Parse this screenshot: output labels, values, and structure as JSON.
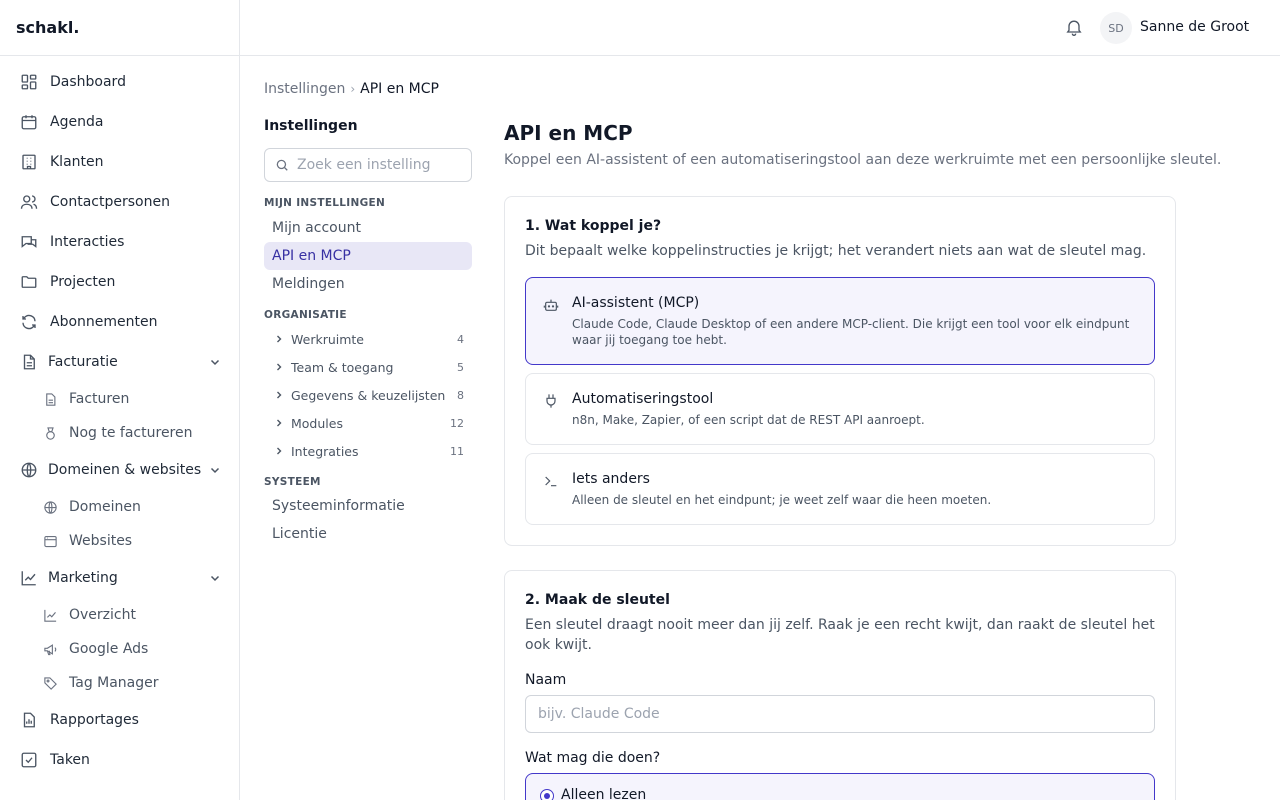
{
  "app": {
    "logo": "schakl."
  },
  "sidebar": {
    "items": [
      {
        "label": "Dashboard",
        "icon": "dashboard-icon"
      },
      {
        "label": "Agenda",
        "icon": "calendar-icon"
      },
      {
        "label": "Klanten",
        "icon": "building-icon"
      },
      {
        "label": "Contactpersonen",
        "icon": "users-icon"
      },
      {
        "label": "Interacties",
        "icon": "messages-icon"
      },
      {
        "label": "Projecten",
        "icon": "folder-icon"
      },
      {
        "label": "Abonnementen",
        "icon": "refresh-icon"
      }
    ],
    "facturatie": {
      "label": "Facturatie",
      "icon": "file-icon",
      "children": [
        {
          "label": "Facturen"
        },
        {
          "label": "Nog te factureren"
        }
      ]
    },
    "domeinen": {
      "label": "Domeinen & websites",
      "icon": "globe-icon",
      "children": [
        {
          "label": "Domeinen"
        },
        {
          "label": "Websites"
        }
      ]
    },
    "marketing": {
      "label": "Marketing",
      "icon": "chart-line-icon",
      "children": [
        {
          "label": "Overzicht"
        },
        {
          "label": "Google Ads"
        },
        {
          "label": "Tag Manager"
        }
      ]
    },
    "bottom": [
      {
        "label": "Rapportages",
        "icon": "report-icon"
      },
      {
        "label": "Taken",
        "icon": "checkbox-icon"
      }
    ]
  },
  "header": {
    "avatar_initials": "SD",
    "user_name": "Sanne de Groot"
  },
  "breadcrumb": {
    "parent": "Instellingen",
    "separator": "›",
    "current": "API en MCP"
  },
  "settings_nav": {
    "title": "Instellingen",
    "search_placeholder": "Zoek een instelling",
    "mijn": {
      "label": "MIJN INSTELLINGEN",
      "items": [
        "Mijn account",
        "API en MCP",
        "Meldingen"
      ]
    },
    "organisatie": {
      "label": "ORGANISATIE",
      "items": [
        {
          "label": "Werkruimte",
          "count": "4"
        },
        {
          "label": "Team & toegang",
          "count": "5"
        },
        {
          "label": "Gegevens & keuzelijsten",
          "count": "8"
        },
        {
          "label": "Modules",
          "count": "12"
        },
        {
          "label": "Integraties",
          "count": "11"
        }
      ]
    },
    "systeem": {
      "label": "SYSTEEM",
      "items": [
        "Systeeminformatie",
        "Licentie"
      ]
    }
  },
  "main": {
    "title": "API en MCP",
    "description": "Koppel een AI-assistent of een automatiseringstool aan deze werkruimte met een persoonlijke sleutel.",
    "step1": {
      "title": "1. Wat koppel je?",
      "description": "Dit bepaalt welke koppelinstructies je krijgt; het verandert niets aan wat de sleutel mag.",
      "options": [
        {
          "title": "AI-assistent (MCP)",
          "description": "Claude Code, Claude Desktop of een andere MCP-client. Die krijgt een tool voor elk eindpunt waar jij toegang toe hebt.",
          "icon": "bot-icon"
        },
        {
          "title": "Automatiseringstool",
          "description": "n8n, Make, Zapier, of een script dat de REST API aanroept.",
          "icon": "plug-icon"
        },
        {
          "title": "Iets anders",
          "description": "Alleen de sleutel en het eindpunt; je weet zelf waar die heen moeten.",
          "icon": "terminal-icon"
        }
      ]
    },
    "step2": {
      "title": "2. Maak de sleutel",
      "description": "Een sleutel draagt nooit meer dan jij zelf. Raak je een recht kwijt, dan raakt de sleutel het ook kwijt.",
      "name_label": "Naam",
      "name_placeholder": "bijv. Claude Code",
      "permission_label": "Wat mag die doen?",
      "permission_option": "Alleen lezen"
    }
  },
  "colors": {
    "accent": "#4338ca",
    "selected_bg": "#f5f4fd",
    "active_nav_bg": "#e8e7f6"
  }
}
